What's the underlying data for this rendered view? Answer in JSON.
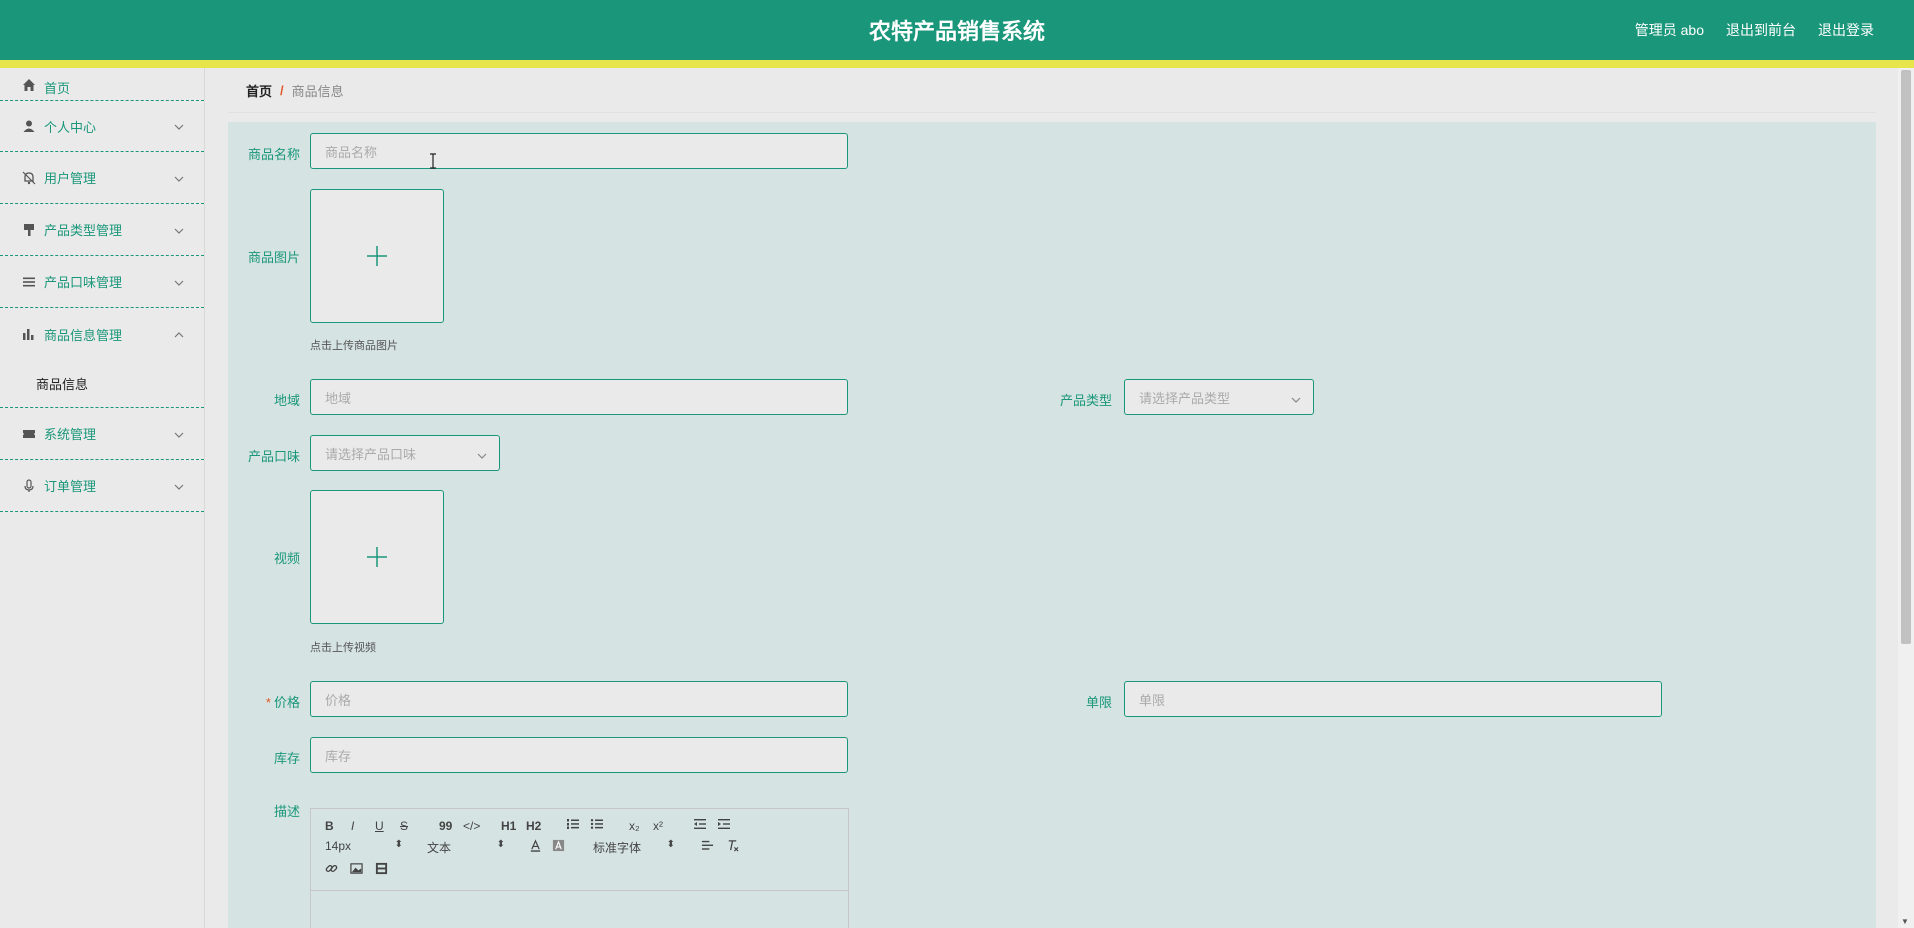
{
  "header": {
    "title": "农特产品销售系统",
    "user": "管理员 abo",
    "to_front": "退出到前台",
    "logout": "退出登录"
  },
  "sidebar": {
    "items": [
      {
        "label": "首页",
        "icon": "home-icon"
      },
      {
        "label": "个人中心",
        "icon": "user-icon"
      },
      {
        "label": "用户管理",
        "icon": "bell-icon"
      },
      {
        "label": "产品类型管理",
        "icon": "brush-icon"
      },
      {
        "label": "产品口味管理",
        "icon": "list-icon"
      },
      {
        "label": "商品信息管理",
        "icon": "bar-chart-icon",
        "expanded": true,
        "children": [
          "商品信息"
        ]
      },
      {
        "label": "系统管理",
        "icon": "ticket-icon"
      },
      {
        "label": "订单管理",
        "icon": "mic-icon"
      }
    ]
  },
  "breadcrumb": {
    "home": "首页",
    "separator": "/",
    "current": "商品信息"
  },
  "form": {
    "name_label": "商品名称",
    "name_placeholder": "商品名称",
    "image_label": "商品图片",
    "image_hint": "点击上传商品图片",
    "region_label": "地域",
    "region_placeholder": "地域",
    "type_label": "产品类型",
    "type_placeholder": "请选择产品类型",
    "flavor_label": "产品口味",
    "flavor_placeholder": "请选择产品口味",
    "video_label": "视频",
    "video_hint": "点击上传视频",
    "required_mark": "*",
    "price_label": "价格",
    "price_placeholder": "价格",
    "limit_label": "单限",
    "limit_placeholder": "单限",
    "stock_label": "库存",
    "stock_placeholder": "库存",
    "desc_label": "描述"
  },
  "editor": {
    "bold": "B",
    "italic": "I",
    "underline": "U",
    "strike": "S",
    "quote": "99",
    "code": "</>",
    "h1": "H1",
    "h2": "H2",
    "sub": "x₂",
    "sup": "x²",
    "size": "14px",
    "paragraph": "文本",
    "font": "标准字体"
  },
  "colors": {
    "primary": "#1a977a",
    "stripe": "#e6e64a",
    "accent": "#e05a2a",
    "panel": "#d5e3e2"
  }
}
